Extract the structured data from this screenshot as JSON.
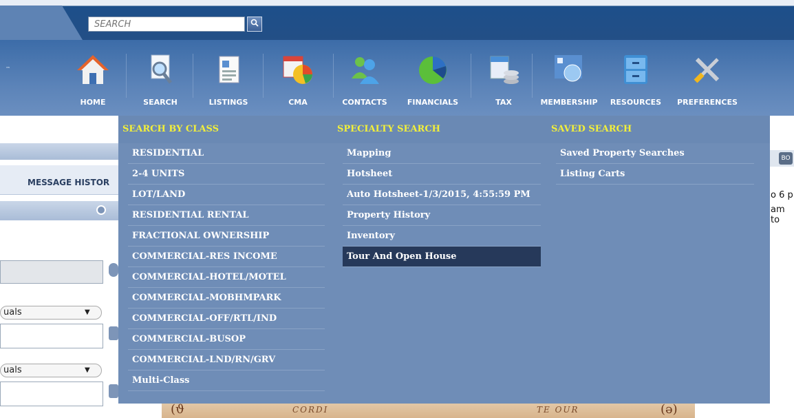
{
  "topbar": {
    "search_placeholder": "SEARCH",
    "search_button_icon": "magnifier-icon"
  },
  "brand": {
    "tm_mark": "™"
  },
  "nav": {
    "items": [
      {
        "label": "HOME",
        "icon": "house-icon"
      },
      {
        "label": "SEARCH",
        "icon": "magnifier-document-icon"
      },
      {
        "label": "LISTINGS",
        "icon": "document-list-icon"
      },
      {
        "label": "CMA",
        "icon": "chart-calendar-icon"
      },
      {
        "label": "CONTACTS",
        "icon": "people-icon"
      },
      {
        "label": "FINANCIALS",
        "icon": "pie-chart-icon"
      },
      {
        "label": "TAX",
        "icon": "coins-document-icon"
      },
      {
        "label": "MEMBERSHIP",
        "icon": "network-globe-icon"
      },
      {
        "label": "RESOURCES",
        "icon": "file-cabinet-icon"
      },
      {
        "label": "PREFERENCES",
        "icon": "tools-icon"
      }
    ]
  },
  "dropdown": {
    "search_by_class": {
      "heading": "SEARCH BY CLASS",
      "items": [
        "RESIDENTIAL",
        "2-4 UNITS",
        "LOT/LAND",
        "RESIDENTIAL RENTAL",
        "FRACTIONAL OWNERSHIP",
        "COMMERCIAL-RES INCOME",
        "COMMERCIAL-HOTEL/MOTEL",
        "COMMERCIAL-MOBHMPARK",
        "COMMERCIAL-OFF/RTL/IND",
        "COMMERCIAL-BUSOP",
        "COMMERCIAL-LND/RN/GRV",
        "Multi-Class"
      ]
    },
    "specialty_search": {
      "heading": "SPECIALTY SEARCH",
      "items": [
        "Mapping",
        "Hotsheet",
        "Auto Hotsheet-1/3/2015, 4:55:59 PM",
        "Property History",
        "Inventory",
        "Tour And Open House"
      ],
      "highlighted_index": 5
    },
    "saved_search": {
      "heading": "SAVED SEARCH",
      "items": [
        "Saved Property Searches",
        "Listing Carts"
      ]
    }
  },
  "background": {
    "message_history": "MESSAGE HISTOR",
    "select_1": "uals",
    "select_2": "uals",
    "right_button": "BO",
    "right_text_1": "o 6 p",
    "right_text_2": "am to",
    "banner_left": "(ϑ",
    "banner_text_1": "CORDI",
    "banner_text_2": "TE OUR",
    "banner_right": "(ə)"
  },
  "colors": {
    "menu_bg": "#6f8db7",
    "menu_heading": "#f2ef3a",
    "menu_active": "#26395a",
    "nav_bg": "#4f7bb2"
  }
}
